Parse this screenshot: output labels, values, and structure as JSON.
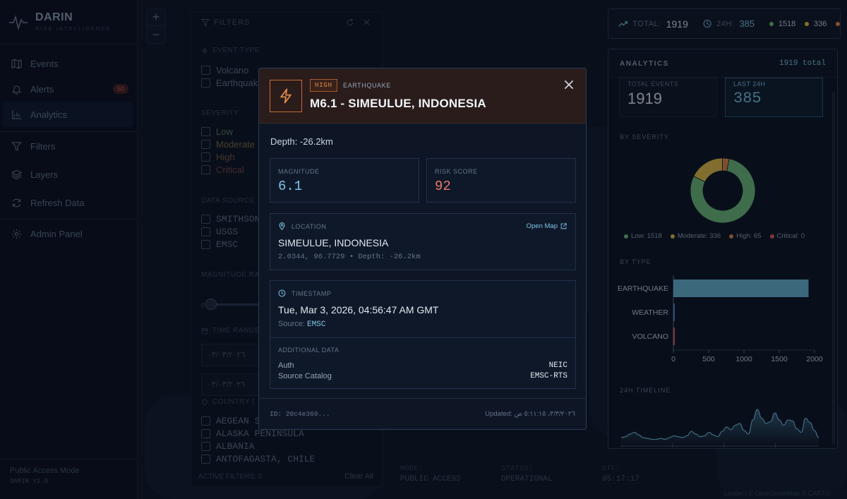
{
  "brand": {
    "name": "DARIN",
    "subtitle": "RISK INTELLIGENCE"
  },
  "nav": [
    {
      "label": "Events",
      "icon": "map-icon"
    },
    {
      "label": "Alerts",
      "icon": "bell-icon",
      "badge": "50"
    },
    {
      "label": "Analytics",
      "icon": "bar-chart-icon"
    },
    {
      "label": "Filters",
      "icon": "filter-icon"
    },
    {
      "label": "Layers",
      "icon": "layers-icon"
    },
    {
      "label": "Refresh Data",
      "icon": "refresh-icon"
    },
    {
      "label": "Admin Panel",
      "icon": "gear-icon"
    }
  ],
  "sidebar_footer": {
    "mode": "Public Access Mode",
    "version": "DARIN V1.0"
  },
  "zoom": {
    "in": "+",
    "out": "−"
  },
  "filters": {
    "title": "FILTERS",
    "event_type_label": "EVENT TYPE",
    "event_types": [
      "Volcano",
      "Earthquake"
    ],
    "severity_label": "SEVERITY",
    "severities": [
      "Low",
      "Moderate",
      "High",
      "Critical"
    ],
    "source_label": "DATA SOURCE",
    "sources": [
      "SMITHSON",
      "USGS",
      "EMSC"
    ],
    "magnitude_label": "MAGNITUDE RAN",
    "magnitude_min": "0",
    "time_label": "TIME RANGE",
    "date_from": "٠٣/٠٣/٢٠٢٦",
    "date_to": "٠٣/٠٣/٢٠٢٦",
    "country_label": "COUNTRY (",
    "countries": [
      "AEGEAN S",
      "ALASKA PENINSULA",
      "ALBANIA",
      "ANTOFAGASTA, CHILE"
    ],
    "active_filters": "ACTIVE FILTERS: 0",
    "clear_all": "Clear All"
  },
  "status": {
    "mode_label": "MODE:",
    "mode_value": "PUBLIC ACCESS",
    "status_label": "STATUS:",
    "status_value": "OPERATIONAL",
    "utc_label": "UTC:",
    "utc_value": "05:17:17"
  },
  "attribution": "Leaflet | © OpenStreetMap © CARTO",
  "statsbar": {
    "total_label": "TOTAL:",
    "total": "1919",
    "h24_label": "24H:",
    "h24": "385",
    "low": "1518",
    "moderate": "336"
  },
  "analytics": {
    "title": "ANALYTICS",
    "total": "1919 total",
    "total_events_label": "TOTAL EVENTS",
    "total_events": "1919",
    "last24_label": "LAST 24H",
    "last24": "385",
    "severity_title": "BY SEVERITY",
    "legend": [
      "Low: 1518",
      "Moderate: 336",
      "High: 65",
      "Critical: 0"
    ],
    "type_title": "BY TYPE",
    "timeline_title": "24H TIMELINE"
  },
  "colors": {
    "low": "#6fbf7f",
    "moderate": "#e8c24a",
    "high": "#e6874a",
    "critical": "#e06060",
    "earthquake": "#6bb6d6",
    "weather": "#5a7fd6",
    "volcano": "#e06060"
  },
  "chart_data": [
    {
      "type": "pie",
      "title": "BY SEVERITY",
      "categories": [
        "Low",
        "Moderate",
        "High",
        "Critical"
      ],
      "values": [
        1518,
        336,
        65,
        0
      ]
    },
    {
      "type": "bar",
      "title": "BY TYPE",
      "categories": [
        "EARTHQUAKE",
        "WEATHER",
        "VOLCANO"
      ],
      "values": [
        1915,
        2,
        2
      ],
      "xlim": [
        0,
        2000
      ],
      "xticks": [
        "0",
        "500",
        "1000",
        "1500",
        "2000"
      ]
    },
    {
      "type": "area",
      "title": "24H TIMELINE",
      "values": [
        8,
        9,
        12,
        14,
        11,
        8,
        7,
        6,
        6,
        7,
        6,
        8,
        10,
        9,
        8,
        10,
        15,
        12,
        9,
        10,
        14,
        11,
        9,
        15,
        20,
        17,
        22,
        24,
        16,
        12,
        28,
        40,
        30,
        24,
        26,
        36,
        28,
        22,
        28,
        27,
        18,
        14,
        30,
        25,
        16,
        8
      ]
    }
  ],
  "modal": {
    "severity": "HIGH",
    "type": "EARTHQUAKE",
    "title": "M6.1 - SIMEULUE, INDONESIA",
    "depth": "Depth: -26.2km",
    "magnitude_label": "MAGNITUDE",
    "magnitude": "6.1",
    "risk_label": "RISK SCORE",
    "risk": "92",
    "location_label": "LOCATION",
    "open_map": "Open Map",
    "location": "SIMEULUE, INDONESIA",
    "coords": "2.0344, 96.7729 • Depth: -26.2km",
    "timestamp_label": "TIMESTAMP",
    "timestamp": "Tue, Mar 3, 2026, 04:56:47 AM GMT",
    "source_prefix": "Source:",
    "source": "EMSC",
    "additional_label": "ADDITIONAL DATA",
    "extra": [
      {
        "k": "Auth",
        "v": "NEIC"
      },
      {
        "k": "Source Catalog",
        "v": "EMSC-RTS"
      }
    ],
    "id": "ID: 20c4e369...",
    "updated": "Updated: ٣/٣/٢٠٢٦، ٥:١١:١٥ ص"
  }
}
